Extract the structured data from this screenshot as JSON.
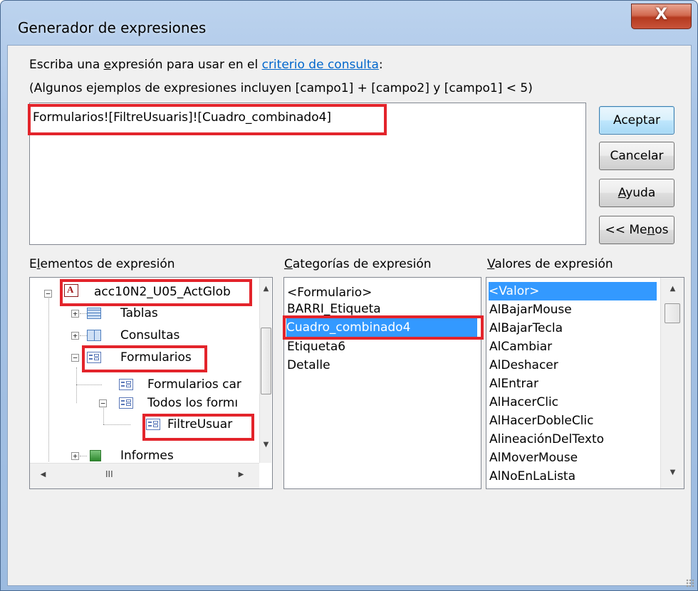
{
  "window": {
    "title": "Generador de expresiones",
    "close_glyph": "X"
  },
  "instructions": {
    "prefix": "Escriba una ",
    "underlined": "e",
    "middle": "xpresión para usar en el ",
    "link": "criterio de consulta",
    "suffix": ":",
    "examples": "(Algunos ejemplos de expresiones incluyen [campo1] + [campo2] y [campo1] < 5)"
  },
  "expression": {
    "value": "Formularios![FiltreUsuaris]![Cuadro_combinado4]"
  },
  "buttons": {
    "ok": "Aceptar",
    "cancel": "Cancelar",
    "help_u": "A",
    "help_rest": "yuda",
    "less_pre": "<< Me",
    "less_u": "n",
    "less_post": "os"
  },
  "elements_panel": {
    "label_pre": "E",
    "label_u": "l",
    "label_post": "ementos de expresión",
    "items": [
      {
        "label": "acc10N2_U05_ActGlob",
        "icon": "access-database-icon"
      },
      {
        "label": "Tablas",
        "icon": "table-icon"
      },
      {
        "label": "Consultas",
        "icon": "query-icon"
      },
      {
        "label": "Formularios",
        "icon": "form-icon"
      },
      {
        "label": "Formularios car",
        "icon": "form-icon"
      },
      {
        "label": "Todos los formı",
        "icon": "form-icon"
      },
      {
        "label": "FiltreUsuar",
        "icon": "form-icon"
      },
      {
        "label": "Informes",
        "icon": "report-icon"
      }
    ],
    "scroll_mark": "III"
  },
  "categories_panel": {
    "label_u": "C",
    "label_rest": "ategorías de expresión",
    "items": [
      "<Formulario>",
      "BARRI_Etiqueta",
      "Cuadro_combinado4",
      "Etiqueta6",
      "Detalle"
    ],
    "selected": "Cuadro_combinado4"
  },
  "values_panel": {
    "label_u": "V",
    "label_rest": "alores de expresión",
    "items": [
      "<Valor>",
      "AlBajarMouse",
      "AlBajarTecla",
      "AlCambiar",
      "AlDeshacer",
      "AlEntrar",
      "AlHacerClic",
      "AlHacerDobleClic",
      "AlineaciónDelTexto",
      "AlMoverMouse",
      "AlNoEnLaLista"
    ],
    "selected": "<Valor>"
  },
  "colors": {
    "highlight": "#3399ff",
    "annotation_red": "#e3242b",
    "link": "#0066cc"
  }
}
